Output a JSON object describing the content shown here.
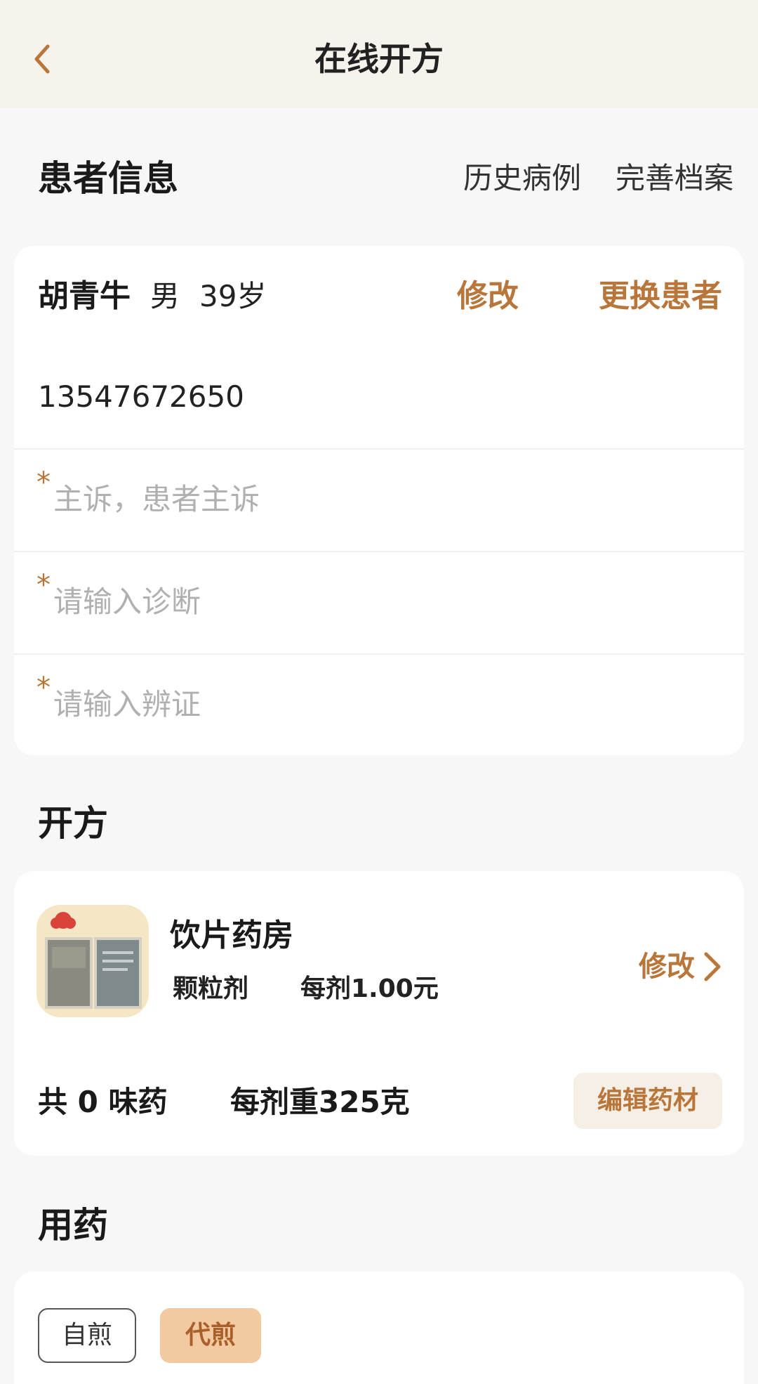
{
  "nav": {
    "title": "在线开方"
  },
  "patient_section": {
    "title": "患者信息",
    "history_label": "历史病例",
    "archive_label": "完善档案"
  },
  "patient": {
    "name": "胡青牛",
    "gender": "男",
    "age": "39岁",
    "modify_label": "修改",
    "change_label": "更换患者",
    "phone": "13547672650"
  },
  "fields": {
    "required_mark": "*",
    "complaint_placeholder": "主诉，患者主诉",
    "diagnosis_placeholder": "请输入诊断",
    "syndrome_placeholder": "请输入辨证"
  },
  "prescription_section": {
    "title": "开方"
  },
  "pharmacy": {
    "name": "饮片药房",
    "dosage_form": "颗粒剂",
    "per_dose_price": "每剂1.00元",
    "modify_label": "修改",
    "herb_count": "共 0 味药",
    "dose_weight": "每剂重325克",
    "edit_label": "编辑药材"
  },
  "usage_section": {
    "title": "用药",
    "self_decoct": "自煎",
    "proxy_decoct": "代煎"
  },
  "colors": {
    "accent": "#b8763a",
    "nav_bg": "#f6f2ec",
    "page_bg": "#f7f7f7",
    "selected_chip_bg": "#f2c9a0"
  }
}
